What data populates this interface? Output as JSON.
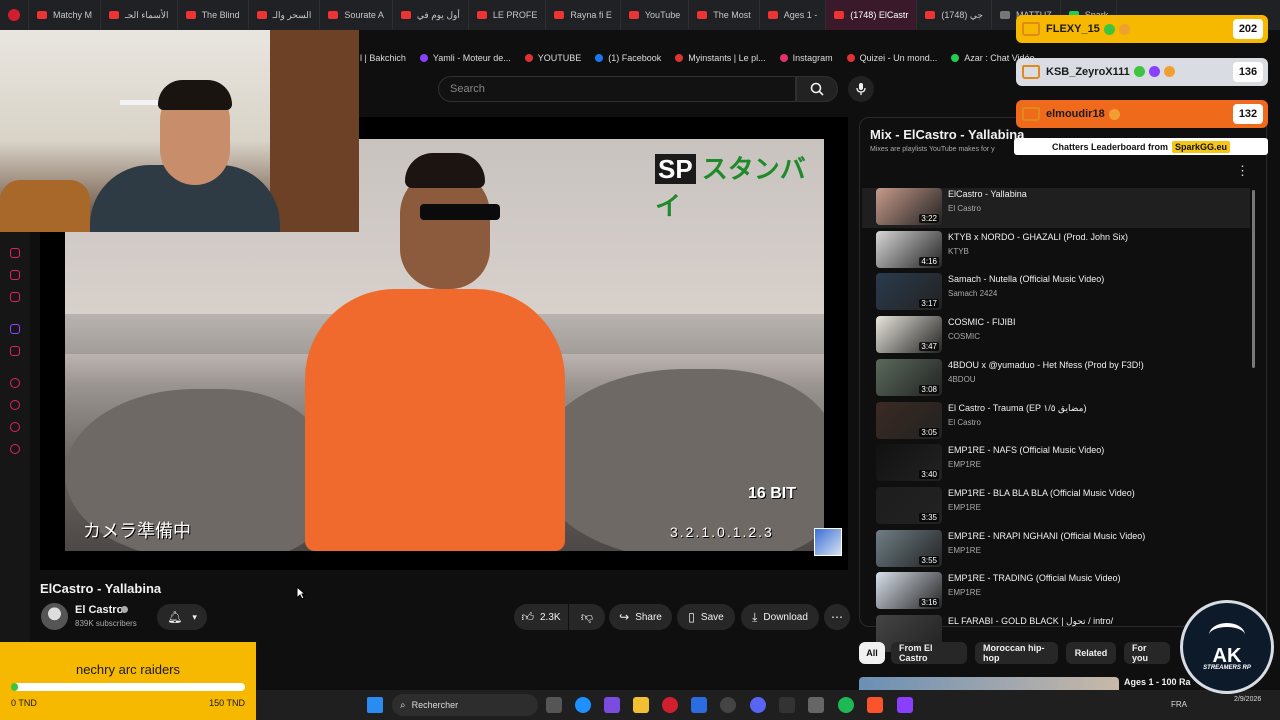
{
  "tabs": [
    {
      "label": "Matchy M"
    },
    {
      "label": "الأسماء الحـ"
    },
    {
      "label": "The Blind"
    },
    {
      "label": "السحر والـ"
    },
    {
      "label": "Sourate A"
    },
    {
      "label": "أول يوم في"
    },
    {
      "label": "LE PROFE"
    },
    {
      "label": "Rayna fi E"
    },
    {
      "label": "YouTube"
    },
    {
      "label": "The Most"
    },
    {
      "label": "Ages 1 -"
    },
    {
      "label": "(1748) ElCastr"
    },
    {
      "label": "(1748) جي"
    },
    {
      "label": "MATTUZ"
    },
    {
      "label": "Spark"
    }
  ],
  "bookmarks": [
    {
      "label": "l | Bakchich"
    },
    {
      "label": "Yamli - Moteur de..."
    },
    {
      "label": "YOUTUBE"
    },
    {
      "label": "(1) Facebook"
    },
    {
      "label": "Myinstants | Le pl..."
    },
    {
      "label": "Instagram"
    },
    {
      "label": "Quizei - Un mond..."
    },
    {
      "label": "Azar : Chat Vidéo..."
    }
  ],
  "search": {
    "placeholder": "Search"
  },
  "video": {
    "overlay_top": "スタンバイ",
    "overlay_sp": "SP",
    "overlay_bit": "16 BIT",
    "overlay_cam": "カメラ準備中",
    "overlay_count": "3.2.1.0.1.2.3"
  },
  "watch": {
    "title": "ElCastro - Yallabina",
    "channel": "El Castro",
    "subscribers": "839K subscribers",
    "likes": "2.3K",
    "share": "Share",
    "save": "Save",
    "download": "Download"
  },
  "goal": {
    "title": "nechry arc raiders",
    "min": "0 TND",
    "max": "150 TND",
    "progress": 0.03
  },
  "playlist": {
    "title": "Mix - ElCastro - Yallabina",
    "subtitle": "Mixes are playlists YouTube makes for y",
    "items": [
      {
        "title": "ElCastro - Yallabina",
        "channel": "El Castro",
        "duration": "3:22",
        "color": "#c79a8a"
      },
      {
        "title": "KTYB x NORDO - GHAZALI (Prod. John Six)",
        "channel": "KTYB",
        "duration": "4:16",
        "color": "#d7d7d7"
      },
      {
        "title": "Samach - Nutella (Official Music Video)",
        "channel": "Samach 2424",
        "duration": "3:17",
        "color": "#2a3b4d"
      },
      {
        "title": "COSMIC - FIJIBI",
        "channel": "COSMIC",
        "duration": "3:47",
        "color": "#e8e6dc"
      },
      {
        "title": "4BDOU x @yumaduo - Het Nfess (Prod by F3D!)",
        "channel": "4BDOU",
        "duration": "3:08",
        "color": "#5a6a5c"
      },
      {
        "title": "El Castro - Trauma (EP مضايق ١/٥)",
        "channel": "El Castro",
        "duration": "3:05",
        "color": "#3a2a22"
      },
      {
        "title": "EMP1RE - NAFS (Official Music Video)",
        "channel": "EMP1RE",
        "duration": "3:40",
        "color": "#111111"
      },
      {
        "title": "EMP1RE - BLA BLA BLA (Official Music Video)",
        "channel": "EMP1RE",
        "duration": "3:35",
        "color": "#1d1d1d"
      },
      {
        "title": "EMP1RE - NRAPI NGHANI (Official Music Video)",
        "channel": "EMP1RE",
        "duration": "3:55",
        "color": "#6f7f86"
      },
      {
        "title": "EMP1RE - TRADING (Official Music Video)",
        "channel": "EMP1RE",
        "duration": "3:16",
        "color": "#d9e0ea"
      },
      {
        "title": "EL FARABI - GOLD BLACK | تحول / intro/",
        "channel": "",
        "duration": "",
        "color": "#444444"
      }
    ]
  },
  "chips": [
    {
      "label": "All",
      "active": true
    },
    {
      "label": "From El Castro",
      "active": false
    },
    {
      "label": "Moroccan hip-hop",
      "active": false
    },
    {
      "label": "Related",
      "active": false
    },
    {
      "label": "For you",
      "active": false
    }
  ],
  "next_title": "Ages 1 - 100 Ra",
  "leaderboard": {
    "rows": [
      {
        "name": "FLEXY_15",
        "score": "202",
        "bg": "#f6b900"
      },
      {
        "name": "KSB_ZeyroX111",
        "score": "136",
        "bg": "#d9dde3"
      },
      {
        "name": "elmoudir18",
        "score": "132",
        "bg": "#f06a1c"
      }
    ],
    "footer_text": "Chatters Leaderboard from",
    "footer_brand": "SparkGG.eu"
  },
  "logo": {
    "main": "AK",
    "sub": "STREAMERS RP"
  },
  "taskbar": {
    "search_label": "Rechercher",
    "lang": "FRA",
    "date": "2/9/2026"
  }
}
